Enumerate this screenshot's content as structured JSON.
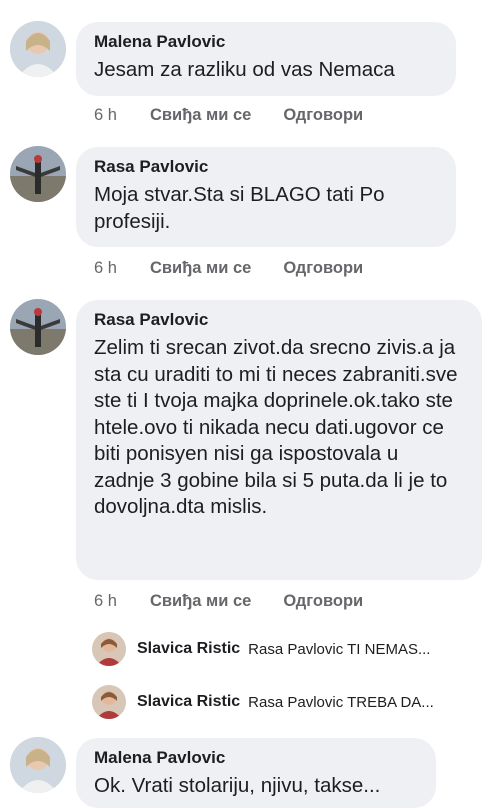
{
  "top_partial": "6 h",
  "comments": [
    {
      "author": "Malena Pavlovic",
      "text": "Jesam za razliku od vas Nemaca",
      "time": "6 h",
      "like": "Свиђа ми се",
      "reply": "Одговори"
    },
    {
      "author": "Rasa Pavlovic",
      "text": "Moja stvar.Sta si BLAGO tati Po profesiji.",
      "time": "6 h",
      "like": "Свиђа ми се",
      "reply": "Одговори"
    },
    {
      "author": "Rasa Pavlovic",
      "text": "Zelim ti srecan zivot.da srecno zivis.a ja sta cu uraditi to mi ti neces zabraniti.sve ste ti I tvoja majka doprinele.ok.tako ste htele.ovo ti nikada necu dati.ugovor ce biti ponisyen nisi ga ispostovala u zadnje 3 gobine bila si 5 puta.da li je to dovoljna.dta mislis.",
      "time": "6 h",
      "like": "Свиђа ми се",
      "reply": "Одговори"
    },
    {
      "author": "Malena Pavlovic",
      "text": "Ok. Vrati stolariju, njivu, takse..."
    }
  ],
  "replies": [
    {
      "author": "Slavica Ristic",
      "text": "Rasa Pavlovic TI NEMAS..."
    },
    {
      "author": "Slavica Ristic",
      "text": "Rasa Pavlovic TREBA DA..."
    }
  ]
}
